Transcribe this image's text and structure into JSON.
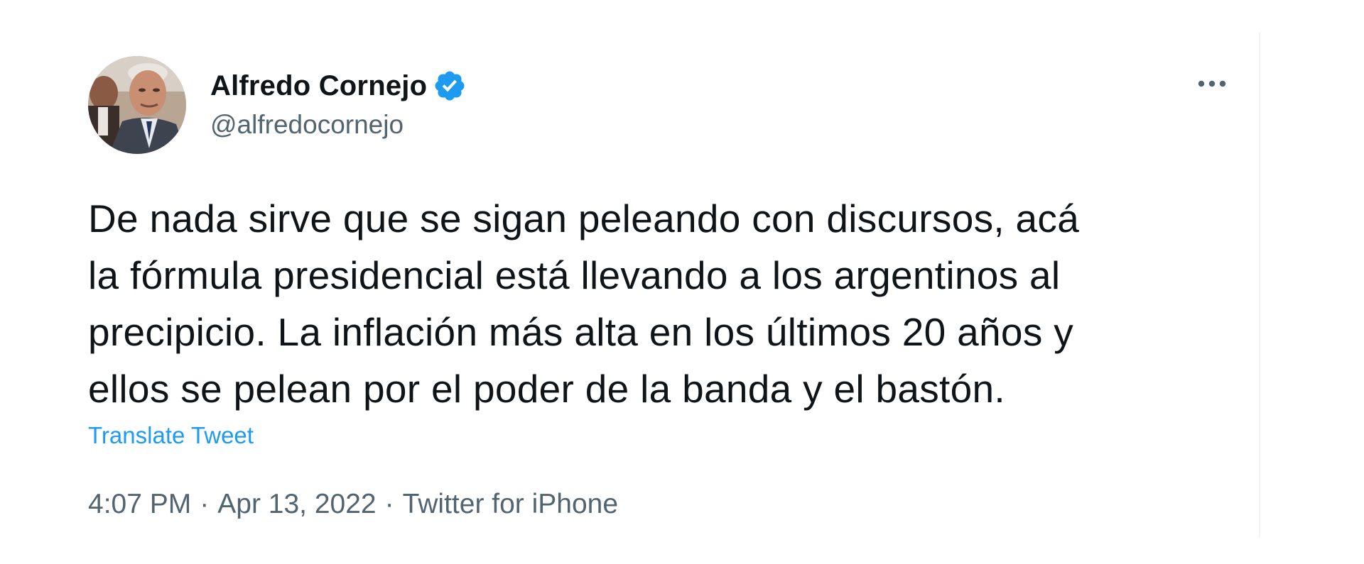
{
  "author": {
    "display_name": "Alfredo Cornejo",
    "handle": "@alfredocornejo",
    "verified": true,
    "avatar_icon": "profile-photo"
  },
  "tweet": {
    "lines": [
      "De nada sirve que se sigan peleando con discursos, acá",
      "la fórmula presidencial está llevando a los argentinos al",
      "precipicio. La inflación más alta en los últimos 20 años y",
      "ellos se pelean por el poder de la banda y el bastón."
    ],
    "translate_label": "Translate Tweet"
  },
  "meta": {
    "time": "4:07 PM",
    "separator": "·",
    "date": "Apr 13, 2022",
    "source": "Twitter for iPhone"
  },
  "icons": {
    "more": "more-horizontal-icon",
    "verified": "verified-badge-icon"
  },
  "colors": {
    "text": "#0f1419",
    "secondary": "#536471",
    "accent": "#1d9bf0"
  }
}
